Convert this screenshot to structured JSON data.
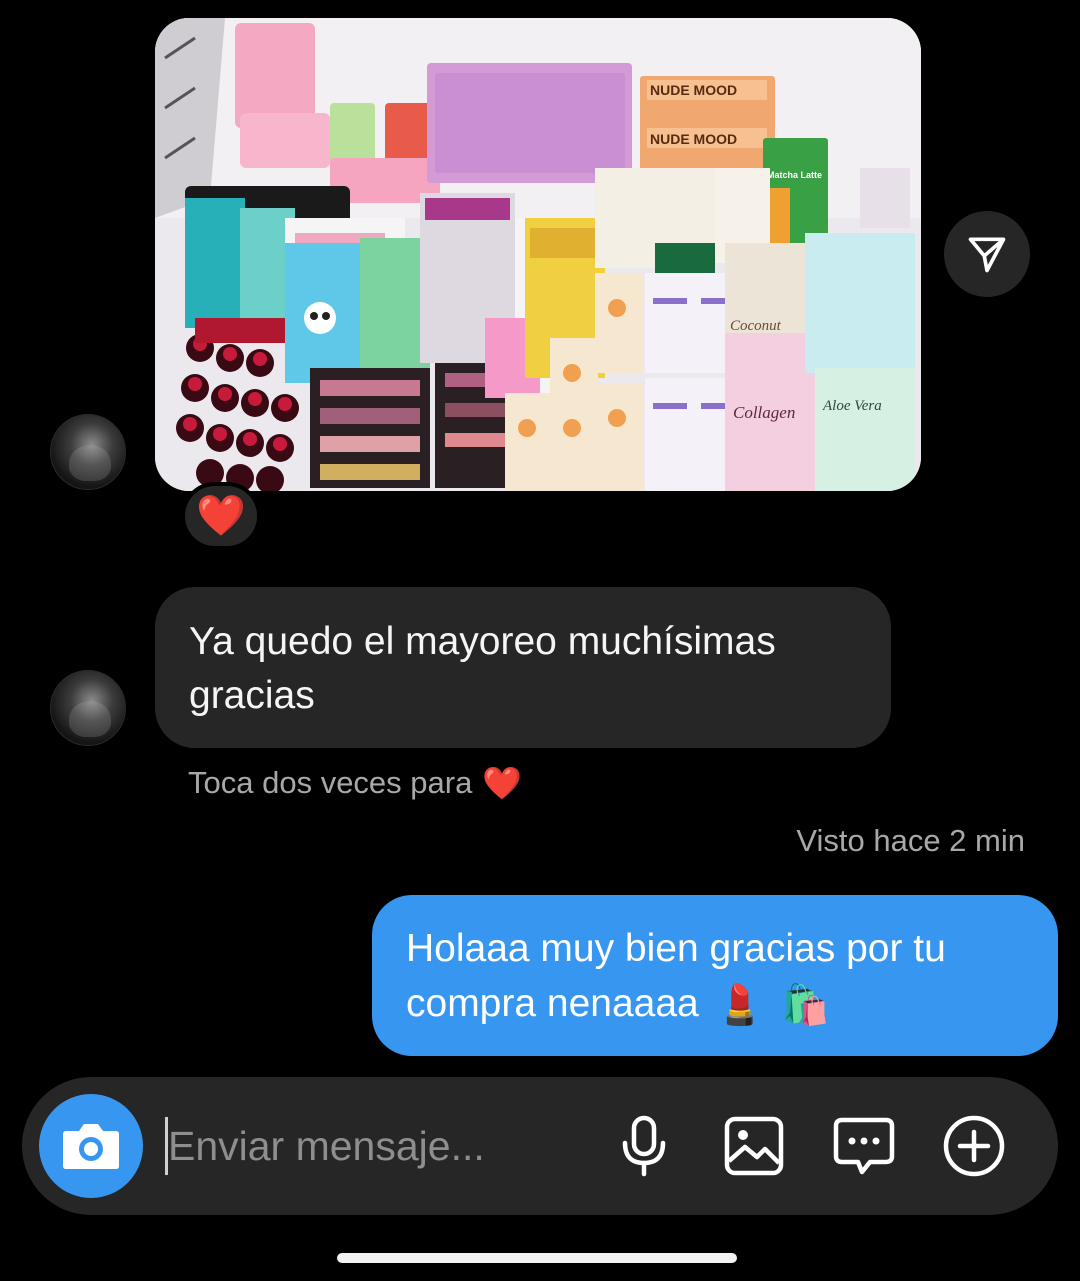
{
  "thread": {
    "photo_message": {
      "reaction": "❤️"
    },
    "incoming_message": {
      "text": "Ya quedo el mayoreo muchísimas gracias",
      "hint": "Toca dos veces para",
      "hint_emoji": "❤️"
    },
    "seen_status": "Visto hace 2 min",
    "outgoing_message": {
      "text": "Holaaa muy bien gracias por tu compra nenaaaa",
      "emoji_1": "💄",
      "emoji_2": "🛍️"
    }
  },
  "composer": {
    "placeholder": "Enviar mensaje...",
    "icons": [
      "camera-icon",
      "microphone-icon",
      "gallery-icon",
      "sticker-icon",
      "plus-icon"
    ]
  },
  "colors": {
    "background": "#000000",
    "incoming_bubble": "#262626",
    "outgoing_bubble": "#3797f0",
    "secondary_text": "#a8a8a8",
    "heart": "#e8202a"
  },
  "photo_labels": {
    "label_1": "NUDE MOOD",
    "label_2": "NUDE MOOD",
    "label_3": "Matcha Latte",
    "label_4": "Coconut",
    "label_5": "Collagen",
    "label_6": "Aloe Vera"
  }
}
